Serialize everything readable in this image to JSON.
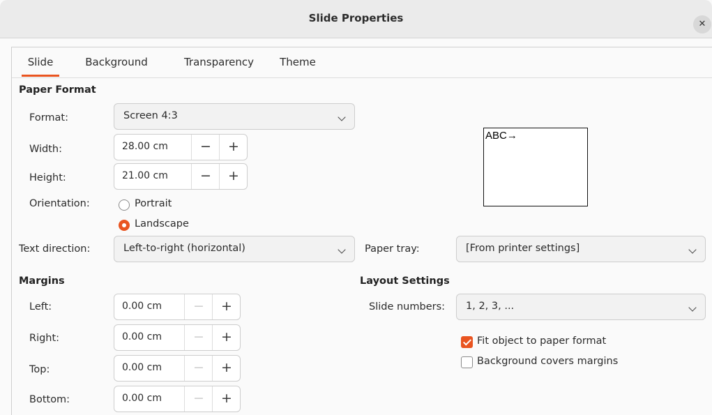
{
  "window": {
    "title": "Slide Properties"
  },
  "tabs": [
    "Slide",
    "Background",
    "Transparency",
    "Theme"
  ],
  "paper_format": {
    "heading": "Paper Format",
    "format_label": "Format:",
    "format_value": "Screen 4:3",
    "width_label": "Width:",
    "width_value": "28.00 cm",
    "height_label": "Height:",
    "height_value": "21.00 cm",
    "orientation_label": "Orientation:",
    "portrait_label": "Portrait",
    "landscape_label": "Landscape",
    "orientation_selected": "Landscape",
    "text_direction_label": "Text direction:",
    "text_direction_value": "Left-to-right (horizontal)",
    "paper_tray_label": "Paper tray:",
    "paper_tray_value": "[From printer settings]"
  },
  "preview": {
    "text": "ABC→"
  },
  "margins": {
    "heading": "Margins",
    "left_label": "Left:",
    "left_value": "0.00 cm",
    "right_label": "Right:",
    "right_value": "0.00 cm",
    "top_label": "Top:",
    "top_value": "0.00 cm",
    "bottom_label": "Bottom:",
    "bottom_value": "0.00 cm"
  },
  "layout": {
    "heading": "Layout Settings",
    "slide_numbers_label": "Slide numbers:",
    "slide_numbers_value": "1, 2, 3, ...",
    "fit_object_label": "Fit object to paper format",
    "fit_object_checked": true,
    "bg_covers_label": "Background covers margins",
    "bg_covers_checked": false
  },
  "glyphs": {
    "minus": "−",
    "plus": "+",
    "close": "✕"
  },
  "colors": {
    "accent": "#e95420"
  }
}
